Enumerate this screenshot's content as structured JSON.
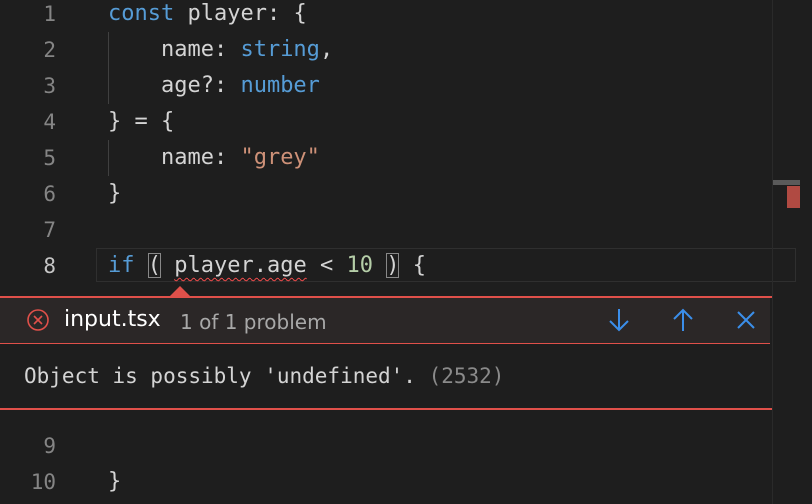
{
  "editor": {
    "lines": [
      {
        "num": "1",
        "tokens": [
          {
            "t": "const",
            "c": "kw"
          },
          {
            "t": " player: {",
            "c": "pl"
          }
        ]
      },
      {
        "num": "2",
        "tokens": [
          {
            "t": "    name: ",
            "c": "pl"
          },
          {
            "t": "string",
            "c": "ty"
          },
          {
            "t": ",",
            "c": "pl"
          }
        ]
      },
      {
        "num": "3",
        "tokens": [
          {
            "t": "    age?: ",
            "c": "pl"
          },
          {
            "t": "number",
            "c": "ty"
          }
        ]
      },
      {
        "num": "4",
        "tokens": [
          {
            "t": "} = {",
            "c": "pl"
          }
        ]
      },
      {
        "num": "5",
        "tokens": [
          {
            "t": "    name: ",
            "c": "pl"
          },
          {
            "t": "\"grey\"",
            "c": "str"
          }
        ]
      },
      {
        "num": "6",
        "tokens": [
          {
            "t": "}",
            "c": "pl"
          }
        ]
      },
      {
        "num": "7",
        "tokens": []
      },
      {
        "num": "8",
        "tokens": [
          {
            "t": "if",
            "c": "kw"
          },
          {
            "t": " ",
            "c": "pl"
          },
          {
            "t": "(",
            "c": "pl paren-box"
          },
          {
            "t": " ",
            "c": "pl"
          },
          {
            "t": "player.age",
            "c": "pl squiggle"
          },
          {
            "t": " < ",
            "c": "pl"
          },
          {
            "t": "10",
            "c": "num"
          },
          {
            "t": " ",
            "c": "pl"
          },
          {
            "t": ")",
            "c": "pl paren-box"
          },
          {
            "t": " {",
            "c": "pl"
          }
        ]
      },
      {
        "num": "9",
        "tokens": []
      },
      {
        "num": "10",
        "tokens": [
          {
            "t": "}",
            "c": "pl"
          }
        ]
      }
    ]
  },
  "peek": {
    "file": "input.tsx",
    "count": "1 of 1 problem",
    "message": "Object is possibly 'undefined'.",
    "code": "(2532)",
    "icons": {
      "error": "error-circle-icon",
      "next": "arrow-down-icon",
      "prev": "arrow-up-icon",
      "close": "close-icon"
    },
    "colors": {
      "error": "#e0504a",
      "accent": "#3b8eea"
    }
  }
}
